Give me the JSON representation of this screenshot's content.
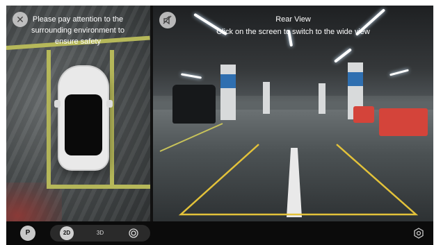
{
  "left_view": {
    "close_icon": "close-icon",
    "notice_text": "Please pay attention to the surrounding environment to ensure safety"
  },
  "right_view": {
    "mute_icon": "speaker-muted-icon",
    "title": "Rear View",
    "instruction": "Click on the screen to switch to the wide view"
  },
  "toolbar": {
    "parking_icon": "auto-parking-icon",
    "parking_label": "P",
    "modes": [
      {
        "label": "2D",
        "icon": "2d-view-icon",
        "active": true
      },
      {
        "label": "3D",
        "icon": "3d-view-icon",
        "active": false
      },
      {
        "label": "",
        "icon": "camera-lens-icon",
        "active": false
      }
    ],
    "settings_icon": "settings-icon"
  },
  "colors": {
    "guide_line": "#e3c23a",
    "lane_marking": "#b6b85a",
    "barrier": "#d4443a"
  }
}
